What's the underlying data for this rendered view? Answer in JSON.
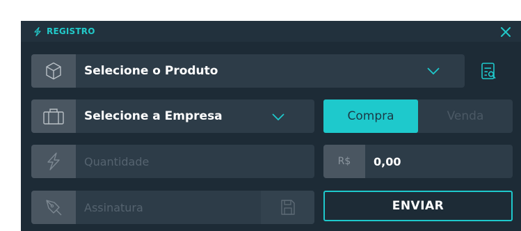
{
  "header": {
    "title": "REGISTRO",
    "bolt_icon": "bolt-icon",
    "close_icon": "close-icon"
  },
  "product": {
    "label": "Selecione o Produto",
    "icon": "cube-icon",
    "search_icon": "search-list-icon"
  },
  "company": {
    "label": "Selecione a Empresa",
    "icon": "briefcase-icon"
  },
  "side_toggle": {
    "options": [
      "Compra",
      "Venda"
    ],
    "selected": "Compra"
  },
  "quantity": {
    "placeholder": "Quantidade",
    "icon": "bolt-icon"
  },
  "price": {
    "currency": "R$",
    "value": "0,00"
  },
  "signature": {
    "placeholder": "Assinatura",
    "icon": "pen-icon",
    "save_icon": "save-icon"
  },
  "submit": {
    "label": "ENVIAR"
  },
  "colors": {
    "accent": "#1ec9cc",
    "panel": "#1d2b36",
    "field": "#2d3c48"
  }
}
